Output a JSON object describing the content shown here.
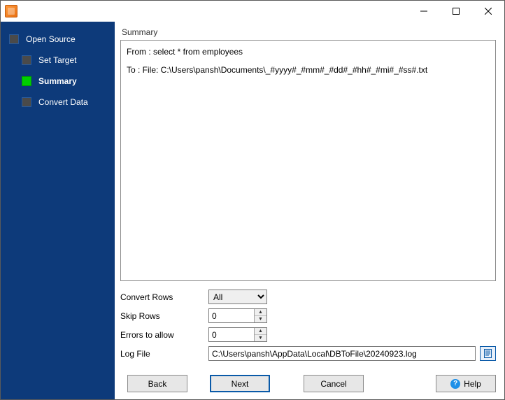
{
  "window": {
    "title": ""
  },
  "sidebar": {
    "items": [
      {
        "label": "Open Source",
        "active": false
      },
      {
        "label": "Set Target",
        "active": false
      },
      {
        "label": "Summary",
        "active": true
      },
      {
        "label": "Convert Data",
        "active": false
      }
    ]
  },
  "panel": {
    "title": "Summary"
  },
  "summary": {
    "from": "From : select * from employees",
    "to": "To : File: C:\\Users\\pansh\\Documents\\_#yyyy#_#mm#_#dd#_#hh#_#mi#_#ss#.txt"
  },
  "form": {
    "convert_rows": {
      "label": "Convert Rows",
      "value": "All",
      "options": [
        "All"
      ]
    },
    "skip_rows": {
      "label": "Skip Rows",
      "value": "0"
    },
    "errors_to_allow": {
      "label": "Errors to allow",
      "value": "0"
    },
    "log_file": {
      "label": "Log File",
      "value": "C:\\Users\\pansh\\AppData\\Local\\DBToFile\\20240923.log"
    }
  },
  "buttons": {
    "back": "Back",
    "next": "Next",
    "cancel": "Cancel",
    "help": "Help"
  }
}
